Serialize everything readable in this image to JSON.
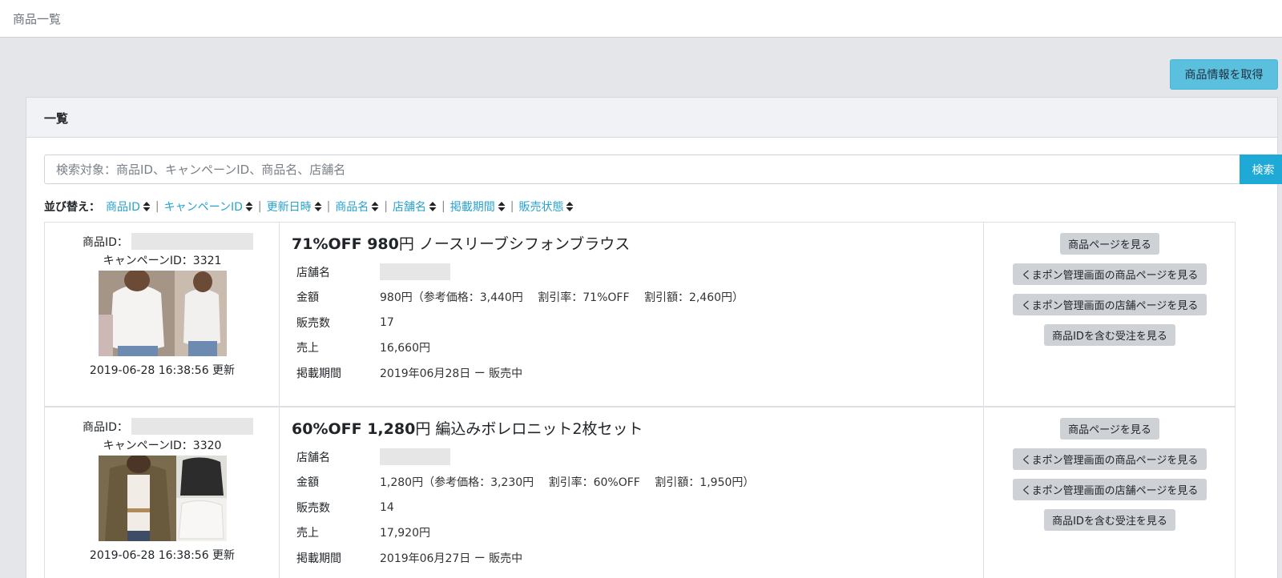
{
  "breadcrumb": "商品一覧",
  "fetch_button": "商品情報を取得",
  "card_title": "一覧",
  "search": {
    "placeholder": "検索対象：商品ID、キャンペーンID、商品名、店舗名",
    "button": "検索"
  },
  "sort": {
    "title": "並び替え：",
    "items": [
      "商品ID",
      "キャンペーンID",
      "更新日時",
      "商品名",
      "店舗名",
      "掲載期間",
      "販売状態"
    ]
  },
  "labels": {
    "product_id": "商品ID：",
    "shop": "店舗名",
    "price": "金額",
    "sold": "販売数",
    "sales": "売上",
    "period": "掲載期間"
  },
  "actions": {
    "view_page": "商品ページを見る",
    "admin_product": "くまポン管理画面の商品ページを見る",
    "admin_shop": "くまポン管理画面の店舗ページを見る",
    "orders": "商品IDを含む受注を見る"
  },
  "products": [
    {
      "campaign": "キャンペーンID：3321",
      "updated": "2019-06-28 16:38:56 更新",
      "title_bold": "71%OFF 980",
      "title_rest": "円 ノースリーブシフォンブラウス",
      "price": "980円（参考価格：3,440円　 割引率：71%OFF　 割引額：2,460円）",
      "sold": "17",
      "sales": "16,660円",
      "period": "2019年06月28日 ー 販売中"
    },
    {
      "campaign": "キャンペーンID：3320",
      "updated": "2019-06-28 16:38:56 更新",
      "title_bold": "60%OFF 1,280",
      "title_rest": "円 編込みボレロニット2枚セット",
      "price": "1,280円（参考価格：3,230円　 割引率：60%OFF　 割引額：1,950円）",
      "sold": "14",
      "sales": "17,920円",
      "period": "2019年06月27日 ー 販売中"
    }
  ]
}
